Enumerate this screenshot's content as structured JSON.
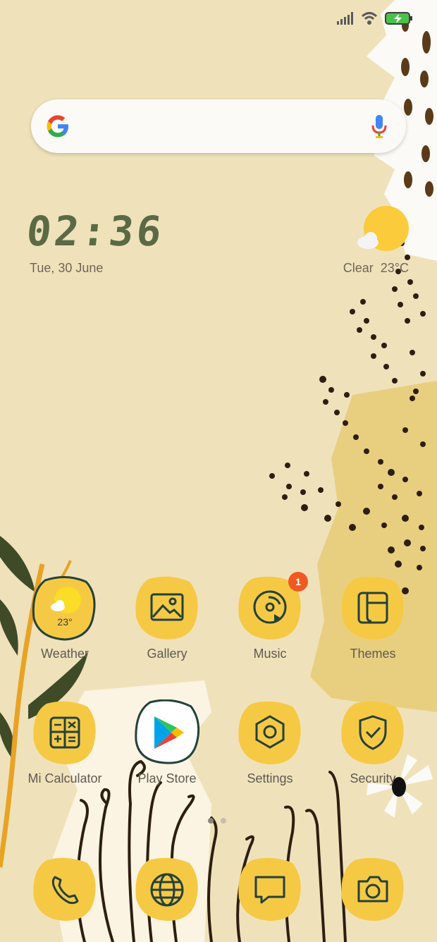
{
  "status_bar": {
    "icons": [
      "signal-icon",
      "wifi-icon",
      "battery-charging-icon"
    ]
  },
  "search": {
    "logo": "google-logo",
    "voice": "mic-icon"
  },
  "clock_widget": {
    "time": "02:36",
    "date": "Tue, 30 June"
  },
  "weather_widget": {
    "condition": "Clear",
    "temperature": "23°C",
    "icon": "sun-cloud-icon"
  },
  "apps": {
    "row1": [
      {
        "label": "Weather",
        "icon": "weather-icon",
        "temp": "23°"
      },
      {
        "label": "Gallery",
        "icon": "gallery-icon"
      },
      {
        "label": "Music",
        "icon": "music-icon",
        "badge": "1"
      },
      {
        "label": "Themes",
        "icon": "themes-icon"
      }
    ],
    "row2": [
      {
        "label": "Mi Calculator",
        "icon": "calculator-icon"
      },
      {
        "label": "Play Store",
        "icon": "play-store-icon"
      },
      {
        "label": "Settings",
        "icon": "settings-icon"
      },
      {
        "label": "Security",
        "icon": "shield-check-icon"
      }
    ]
  },
  "page_indicator": {
    "pages": 2,
    "current": 1
  },
  "dock": [
    {
      "icon": "phone-icon"
    },
    {
      "icon": "browser-globe-icon"
    },
    {
      "icon": "messages-icon"
    },
    {
      "icon": "camera-icon"
    }
  ],
  "colors": {
    "wallpaper": "#efe2bb",
    "icon_yellow": "#f6c945",
    "icon_stroke": "#24413a",
    "text": "#5e5a50",
    "clock": "#5a6a45",
    "badge": "#f05a21"
  }
}
